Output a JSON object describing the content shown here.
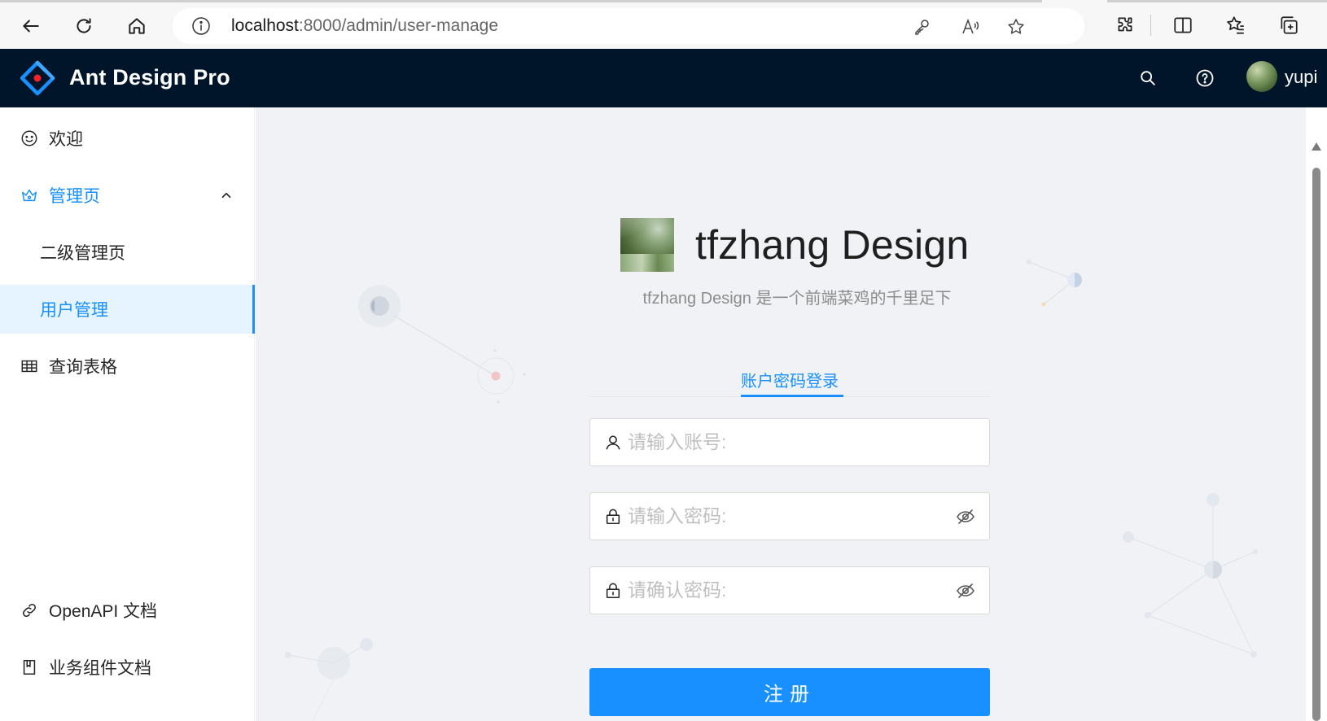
{
  "browser": {
    "url_host": "localhost",
    "url_rest": ":8000/admin/user-manage",
    "icons": {
      "back": "back-arrow-icon",
      "reload": "reload-icon",
      "home": "home-icon",
      "info": "info-icon",
      "key": "key-icon",
      "read_aloud": "read-aloud-icon",
      "favorite": "star-icon",
      "extensions": "puzzle-icon",
      "split": "split-screen-icon",
      "favorites_list": "favorites-icon",
      "collections": "collections-icon"
    }
  },
  "header": {
    "title": "Ant Design Pro",
    "username": "yupi",
    "background": "#001529",
    "icons": {
      "search": "search-icon",
      "help": "question-circle-icon"
    }
  },
  "sidebar": {
    "items": [
      {
        "label": "欢迎",
        "icon": "smile-icon"
      },
      {
        "label": "管理页",
        "icon": "crown-icon",
        "expanded": true
      },
      {
        "label": "二级管理页",
        "sub": true
      },
      {
        "label": "用户管理",
        "sub": true,
        "selected": true
      },
      {
        "label": "查询表格",
        "icon": "table-icon"
      }
    ],
    "footer_links": [
      {
        "label": "OpenAPI 文档",
        "icon": "link-icon"
      },
      {
        "label": "业务组件文档",
        "icon": "book-icon"
      }
    ]
  },
  "register": {
    "brand_title": "tfzhang Design",
    "brand_subtitle": "tfzhang Design 是一个前端菜鸡的千里足下",
    "tab_label": "账户密码登录",
    "account_placeholder": "请输入账号:",
    "password_placeholder": "请输入密码:",
    "confirm_placeholder": "请确认密码:",
    "submit_label": "注册",
    "accent": "#1890ff"
  }
}
